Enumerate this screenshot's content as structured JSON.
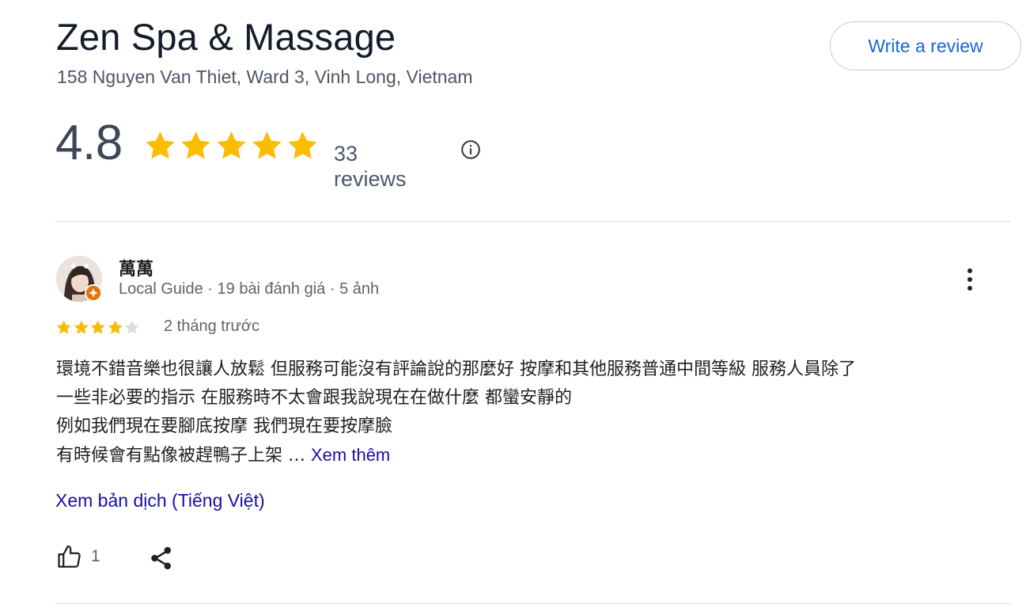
{
  "place": {
    "name": "Zen Spa & Massage",
    "address": "158 Nguyen Van Thiet, Ward 3, Vinh Long, Vietnam"
  },
  "header": {
    "write_review_label": "Write a review"
  },
  "summary": {
    "rating": "4.8",
    "stars": 5,
    "review_count_label": "33 reviews",
    "star_color": "#fbbc04"
  },
  "review": {
    "author": "萬萬",
    "author_meta": "Local Guide · 19 bài đánh giá · 5 ảnh",
    "rating": 4,
    "time": "2 tháng trước",
    "text_lines": [
      "環境不錯音樂也很讓人放鬆 但服務可能沒有評論說的那麼好 按摩和其他服務普通中間等級 服務人員除了",
      "一些非必要的指示 在服務時不太會跟我說現在在做什麼 都蠻安靜的",
      "例如我們現在要腳底按摩 我們現在要按摩臉",
      "有時候會有點像被趕鴨子上架 …"
    ],
    "read_more_label": "Xem thêm",
    "translate_label": "Xem bản dịch (Tiếng Việt)",
    "like_count": "1",
    "icons": {
      "like": "thumbs-up-icon",
      "share": "share-icon",
      "menu": "more-vert-icon",
      "badge": "local-guide-badge-icon",
      "info": "info-icon"
    },
    "badge_color": "#e8710a",
    "link_color": "#1a0dab"
  }
}
